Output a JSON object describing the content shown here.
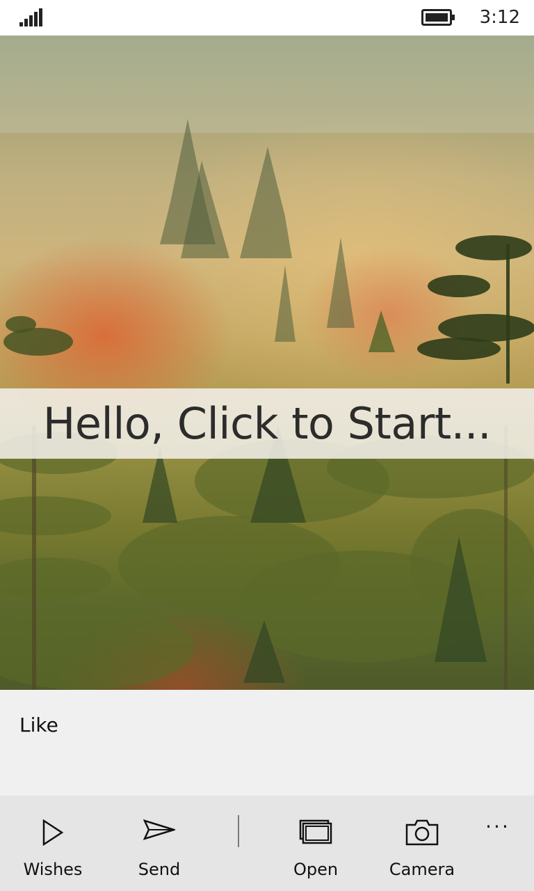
{
  "status_bar": {
    "time": "3:12",
    "signal_icon": "signal-bars-icon",
    "battery_icon": "battery-full-icon"
  },
  "hero": {
    "image_icon": "forest-photo",
    "title": "Hello, Click to Start..."
  },
  "content": {
    "like_label": "Like"
  },
  "app_bar": {
    "buttons": [
      {
        "label": "Wishes",
        "icon": "play-icon"
      },
      {
        "label": "Send",
        "icon": "send-icon"
      },
      {
        "label": "Open",
        "icon": "open-icon"
      },
      {
        "label": "Camera",
        "icon": "camera-icon"
      }
    ],
    "more": "···"
  },
  "colors": {
    "status_bar_bg": "#ffffff",
    "title_band_bg": "#f1efe8",
    "content_bg": "#f0f0f0",
    "app_bar_bg": "#e5e5e5"
  }
}
